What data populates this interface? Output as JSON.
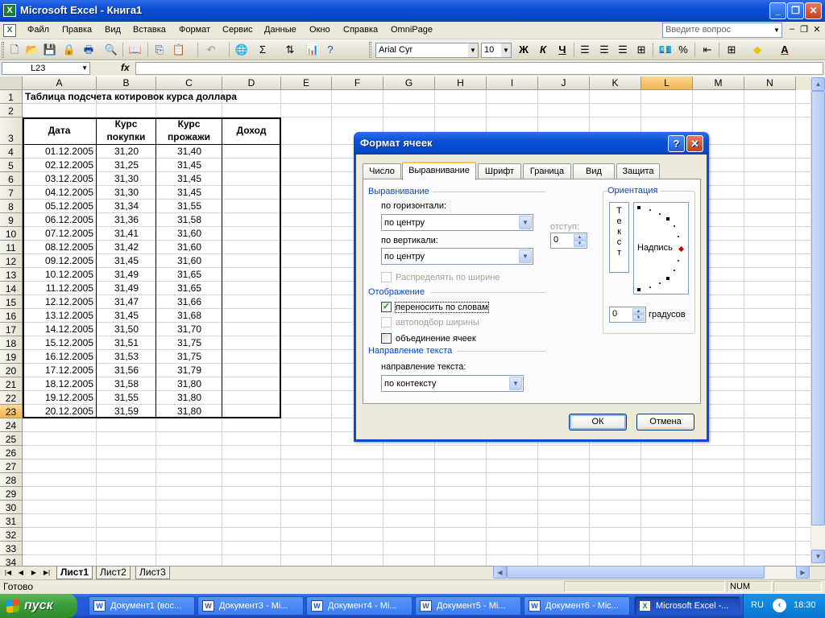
{
  "window": {
    "title": "Microsoft Excel - Книга1"
  },
  "menu": {
    "items": [
      "Файл",
      "Правка",
      "Вид",
      "Вставка",
      "Формат",
      "Сервис",
      "Данные",
      "Окно",
      "Справка",
      "OmniPage"
    ],
    "help_placeholder": "Введите вопрос"
  },
  "toolbar": {
    "font_name": "Arial Cyr",
    "font_size": "10",
    "bold": "Ж",
    "italic": "К",
    "underline": "Ч",
    "sum": "Σ",
    "percent": "%"
  },
  "formula_bar": {
    "cell_ref": "L23",
    "fx": "fx",
    "formula": ""
  },
  "sheet": {
    "columns": [
      "A",
      "B",
      "C",
      "D",
      "E",
      "F",
      "G",
      "H",
      "I",
      "J",
      "K",
      "L",
      "M",
      "N"
    ],
    "selected_column": "L",
    "rows": [
      "1",
      "2",
      "3",
      "4",
      "5",
      "6",
      "7",
      "8",
      "9",
      "10",
      "11",
      "12",
      "13",
      "14",
      "15",
      "16",
      "17",
      "18",
      "19",
      "20",
      "21",
      "22",
      "23",
      "24",
      "25",
      "26",
      "27",
      "28",
      "29",
      "30",
      "31",
      "32",
      "33",
      "34"
    ],
    "selected_row": "23",
    "title": "Таблица подсчета котировок курса доллара",
    "headers": [
      "Дата",
      "Курс покупки",
      "Курс прожажи",
      "Доход"
    ],
    "data": [
      [
        "01.12.2005",
        "31,20",
        "31,40"
      ],
      [
        "02.12.2005",
        "31,25",
        "31,45"
      ],
      [
        "03.12.2005",
        "31,30",
        "31,45"
      ],
      [
        "04.12.2005",
        "31,30",
        "31,45"
      ],
      [
        "05.12.2005",
        "31,34",
        "31,55"
      ],
      [
        "06.12.2005",
        "31,36",
        "31,58"
      ],
      [
        "07.12.2005",
        "31,41",
        "31,60"
      ],
      [
        "08.12.2005",
        "31,42",
        "31,60"
      ],
      [
        "09.12.2005",
        "31,45",
        "31,60"
      ],
      [
        "10.12.2005",
        "31,49",
        "31,65"
      ],
      [
        "11.12.2005",
        "31,49",
        "31,65"
      ],
      [
        "12.12.2005",
        "31,47",
        "31,66"
      ],
      [
        "13.12.2005",
        "31,45",
        "31,68"
      ],
      [
        "14.12.2005",
        "31,50",
        "31,70"
      ],
      [
        "15.12.2005",
        "31,51",
        "31,75"
      ],
      [
        "16.12.2005",
        "31,53",
        "31,75"
      ],
      [
        "17.12.2005",
        "31,56",
        "31,79"
      ],
      [
        "18.12.2005",
        "31,58",
        "31,80"
      ],
      [
        "19.12.2005",
        "31,55",
        "31,80"
      ],
      [
        "20.12.2005",
        "31,59",
        "31,80"
      ]
    ]
  },
  "sheet_tabs": [
    "Лист1",
    "Лист2",
    "Лист3"
  ],
  "status": {
    "text": "Готово",
    "num": "NUM"
  },
  "taskbar": {
    "start": "пуск",
    "tasks": [
      "Документ1 (вос...",
      "Документ3 - Mi...",
      "Документ4 - Mi...",
      "Документ5 - Mi...",
      "Документ6 - Mic...",
      "Microsoft Excel -..."
    ],
    "lang": "RU",
    "time": "18:30"
  },
  "dialog": {
    "title": "Формат ячеек",
    "help": "?",
    "close": "✕",
    "tabs": [
      "Число",
      "Выравнивание",
      "Шрифт",
      "Граница",
      "Вид",
      "Защита"
    ],
    "active_tab": "Выравнивание",
    "alignment_group": "Выравнивание",
    "horizontal_label": "по горизонтали:",
    "horizontal_value": "по центру",
    "indent_label": "отступ:",
    "indent_value": "0",
    "vertical_label": "по вертикали:",
    "vertical_value": "по центру",
    "distribute_label": "Распределять по ширине",
    "display_group": "Отображение",
    "wrap_label": "переносить по словам",
    "wrap_checked": true,
    "shrink_label": "автоподбор ширины",
    "merge_label": "объединение ячеек",
    "direction_group": "Направление текста",
    "direction_label": "направление текста:",
    "direction_value": "по контексту",
    "orientation_group": "Ориентация",
    "vertical_text": "Текст",
    "caption": "Надпись",
    "degrees_value": "0",
    "degrees_label": "градусов",
    "ok": "ОК",
    "cancel": "Отмена"
  }
}
